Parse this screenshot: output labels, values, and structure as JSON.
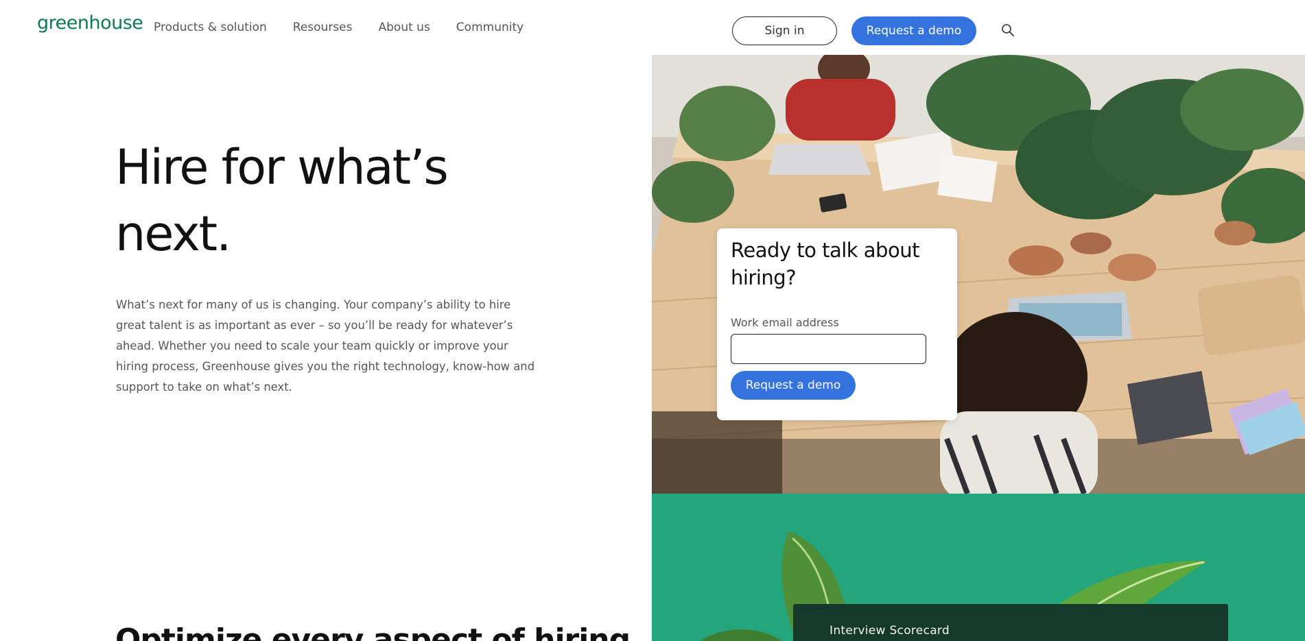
{
  "header": {
    "logo": "greenhouse",
    "nav": [
      {
        "label": "Products & solution"
      },
      {
        "label": "Resourses"
      },
      {
        "label": "About us"
      },
      {
        "label": "Community"
      }
    ],
    "sign_in_label": "Sign in",
    "request_demo_label": "Request a demo",
    "search_icon": "search-icon"
  },
  "hero": {
    "title_line1": "Hire for what’s",
    "title_line2": "next.",
    "body": "What’s next for many of us is changing. Your company’s ability to hire great talent is as important as ever – so you’ll be ready for whatever’s ahead. Whether you need to scale your team quickly or improve your hiring process, Greenhouse gives you the right technology, know-how and support to take on what’s next."
  },
  "demo_card": {
    "title": "Ready to talk about hiring?",
    "email_label": "Work email address",
    "email_value": "",
    "button_label": "Request a demo"
  },
  "section": {
    "heading": "Optimize every aspect of hiring"
  },
  "scorecard": {
    "title": "Interview Scorecard"
  },
  "colors": {
    "brand_green": "#0d7a55",
    "panel_green": "#24a57b",
    "primary_blue": "#3473de",
    "scorecard_dark": "#153a2c"
  }
}
